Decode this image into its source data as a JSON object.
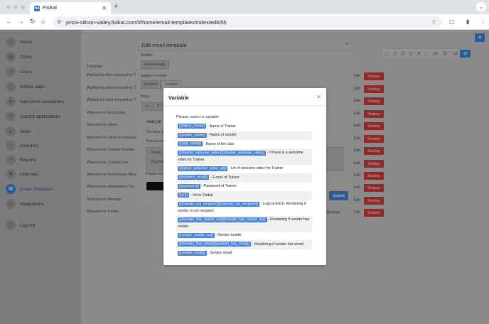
{
  "browser": {
    "tab_title": "Fisikal",
    "tab_favicon": "fsk",
    "url": "ymca-silicon-valley.fisikal.com/#/home/email-templates/index/edit/55"
  },
  "sidebar": {
    "items": [
      {
        "label": "Home",
        "icon": "home-icon"
      },
      {
        "label": "Clubs",
        "icon": "clubs-icon"
      },
      {
        "label": "Users",
        "icon": "users-icon"
      },
      {
        "label": "Mobile apps",
        "icon": "mobile-icon"
      },
      {
        "label": "Insurance companies",
        "icon": "insurance-icon"
      },
      {
        "label": "Oauth2 applications",
        "icon": "oauth-icon"
      },
      {
        "label": "Stats",
        "icon": "stats-icon"
      },
      {
        "label": "Counters",
        "icon": "counters-icon"
      },
      {
        "label": "Reports",
        "icon": "reports-icon"
      },
      {
        "label": "Licenses",
        "icon": "licenses-icon"
      },
      {
        "label": "Email Templates",
        "icon": "email-icon"
      },
      {
        "label": "Integrations",
        "icon": "integrations-icon"
      },
      {
        "label": "Log out",
        "icon": "logout-icon"
      }
    ],
    "active_index": 10
  },
  "pagination": {
    "pages": [
      "‹",
      "1",
      "2",
      "3",
      "4",
      "…",
      "10",
      "11",
      "12",
      "13"
    ],
    "current": "13"
  },
  "templates": {
    "header": "Template",
    "rows": [
      "Waiting list client removed by T",
      "Waiting list client removed by T",
      "Waiting list client removed by T",
      "Welcome for Accountant",
      "Welcome for Client",
      "Welcome for Client of Independ",
      "Welcome for Content Provider",
      "Welcome for Content User",
      "Welcome for Front House Mana",
      "Welcome for Independent Trai",
      "Welcome for Manager",
      "Welcome for Trainer"
    ],
    "edit_label": "Edit",
    "destroy_label": "Destroy",
    "extra_text": "w Message"
  },
  "edit_modal": {
    "title": "Edit email template",
    "sender_label": "Sender",
    "sender_value": "Automatically",
    "subject_label": "Subject of email",
    "disabled_label": "Disabled",
    "enabled_label": "Enabled",
    "body_label": "Body:",
    "code_btn": "<>",
    "para_btn": "¶",
    "body_line1": "Hello {{tr",
    "body_line2": "You have b",
    "body_line3": "Your accou",
    "email_label": "Email:",
    "password_label": "Passwo",
    "download_text": "Please dov",
    "update_label": "Update"
  },
  "variable_modal": {
    "title": "Variable",
    "prompt": "Please, select a variable:",
    "variables": [
      {
        "tag": "{{trainer_name}}",
        "desc": " - Name of Trainer"
      },
      {
        "tag": "{{sender_name}}",
        "desc": " - Name of sender"
      },
      {
        "tag": "{{club_name}}",
        "desc": " - Name of the club"
      },
      {
        "tag": "{{#trainer_welcome_video}}{{/trainer_welcome_video}}",
        "desc": " - If there is a welcome video for Trainer"
      },
      {
        "tag": "{{trainer_welcome_video_url}}",
        "desc": " - Url of welcome video for Trainer"
      },
      {
        "tag": "{{recipient_email}}",
        "desc": " - E-mail of Trainer"
      },
      {
        "tag": "{{password}}",
        "desc": " - Password of Trainer"
      },
      {
        "tag": "{{url}}",
        "desc": " - Url to Fisikal"
      },
      {
        "tag": "{{#sender_not_recipient}}{{/sender_not_recipient}}",
        "desc": " - Logical block. Rendering if sender is not recipient"
      },
      {
        "tag": "{{#sender_has_mobile_no}}{{/sender_has_mobile_no}}",
        "desc": " - Rendering if sender has mobile"
      },
      {
        "tag": "{{sender_mobile_no}}",
        "desc": " - Sender mobile"
      },
      {
        "tag": "{{#sender_has_email}}{{/sender_has_email}}",
        "desc": " - Rendering if sender has email"
      },
      {
        "tag": "{{sender_email}}",
        "desc": " - Sender email"
      }
    ]
  },
  "colors": {
    "accent": "#2d5b95",
    "destroy": "#8e2a2a",
    "tag": "#4a7fcf"
  }
}
